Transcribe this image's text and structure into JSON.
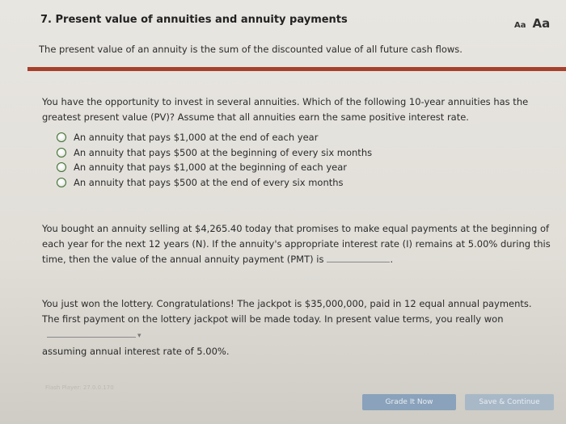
{
  "header": {
    "title": "7. Present value of annuities and annuity payments",
    "font_small_label": "Aa",
    "font_large_label": "Aa"
  },
  "intro": "The present value of an annuity is the sum of the discounted value of all future cash flows.",
  "question1": {
    "text": "You have the opportunity to invest in several annuities. Which of the following 10-year annuities has the greatest present value (PV)? Assume that all annuities earn the same positive interest rate.",
    "options": [
      "An annuity that pays $1,000 at the end of each year",
      "An annuity that pays $500 at the beginning of every six months",
      "An annuity that pays $1,000 at the beginning of each year",
      "An annuity that pays $500 at the end of every six months"
    ]
  },
  "question2": {
    "text": "You bought an annuity selling at $4,265.40 today that promises to make equal payments at the beginning of each year for the next 12 years (N). If the annuity's appropriate interest rate (I) remains at 5.00% during this time, then the value of the annual annuity payment (PMT) is",
    "suffix": "."
  },
  "question3": {
    "text_before": "You just won the lottery. Congratulations! The jackpot is $35,000,000, paid in 12 equal annual payments. The first payment on the lottery jackpot will be made today. In present value terms, you really won",
    "text_after": "assuming annual interest rate of 5.00%."
  },
  "footer": {
    "grade_label": "Grade It Now",
    "save_label": "Save & Continue",
    "faded_text": "Flash Player: 27.0.0.170"
  },
  "colors": {
    "accent_rule": "#a6402c",
    "radio_ring": "#3c6e2a",
    "grade_button": "#8aa2bb",
    "save_button": "#a8b8c7"
  }
}
